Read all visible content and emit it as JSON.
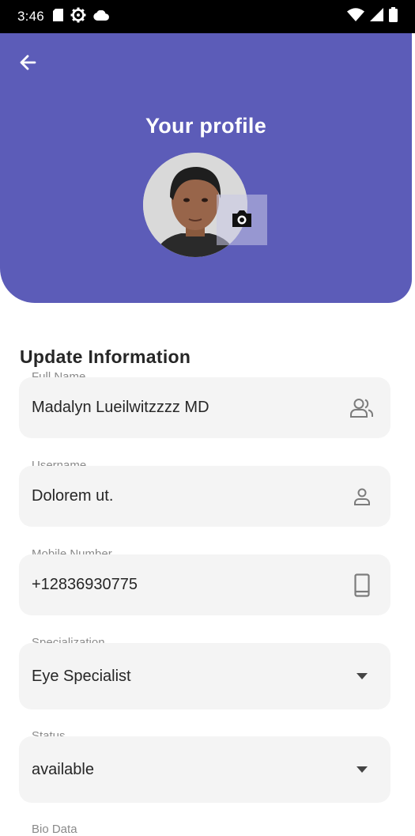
{
  "status_bar": {
    "time": "3:46",
    "left_icons": [
      "sim-card-icon",
      "gear-icon",
      "cloud-icon"
    ],
    "right_icons": [
      "wifi-icon",
      "signal-icon",
      "battery-icon"
    ]
  },
  "header": {
    "title": "Your profile",
    "back_icon": "arrow-left-icon",
    "camera_icon": "camera-icon",
    "background_color": "#5c5cb8"
  },
  "form": {
    "section_title": "Update Information",
    "fields": [
      {
        "label": "Full Name",
        "value": "Madalyn Lueilwitzzzz MD",
        "icon": "people-icon"
      },
      {
        "label": "Username",
        "value": "Dolorem ut.",
        "icon": "person-icon"
      },
      {
        "label": "Mobile Number",
        "value": "+12836930775",
        "icon": "phone-icon"
      },
      {
        "label": "Specialization",
        "value": "Eye Specialist",
        "icon": "dropdown-arrow-icon"
      },
      {
        "label": "Status",
        "value": "available",
        "icon": "dropdown-arrow-icon"
      },
      {
        "label": "Bio Data"
      }
    ]
  }
}
